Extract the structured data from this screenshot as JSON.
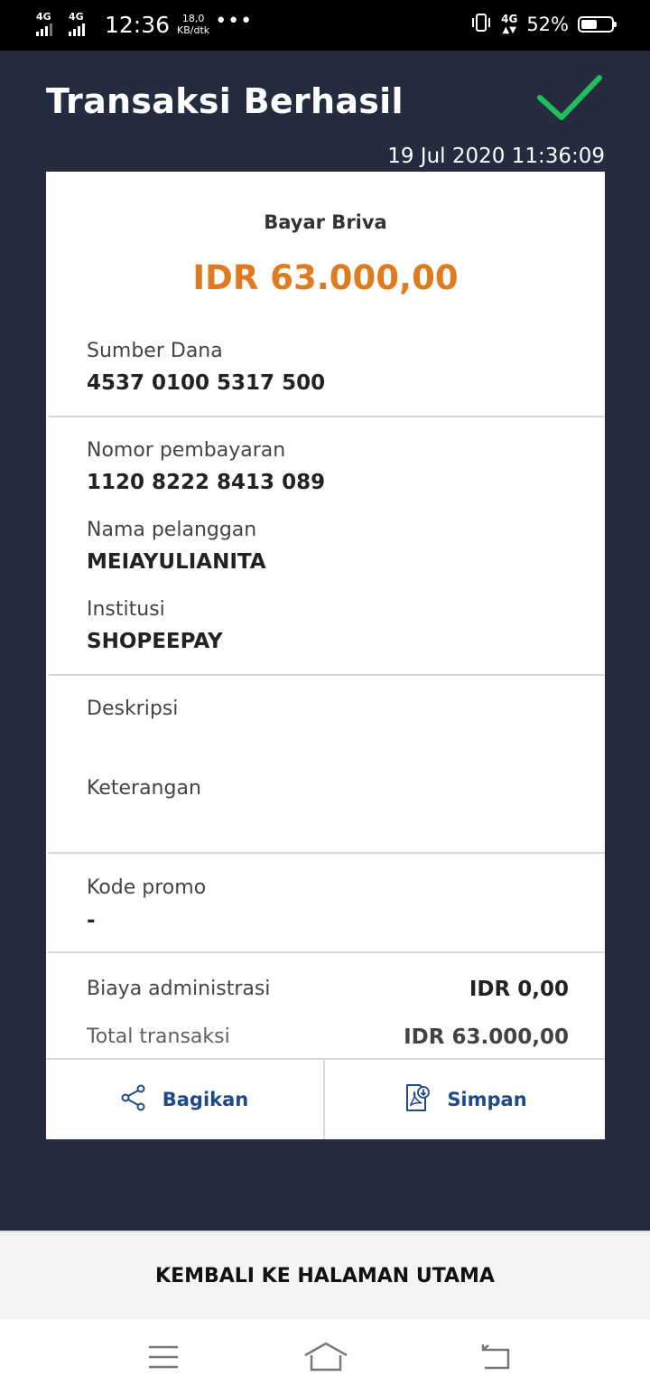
{
  "status_bar": {
    "network1": "4G",
    "network2": "4G",
    "time": "12:36",
    "speed_value": "18,0",
    "speed_unit": "KB/dtk",
    "dots": "•••",
    "network_right": "4G",
    "battery_percent": "52%",
    "battery_level": 0.52
  },
  "header": {
    "title": "Transaksi Berhasil",
    "timestamp": "19 Jul 2020 11:36:09",
    "check_color": "#1fbf5c"
  },
  "receipt": {
    "product": "Bayar Briva",
    "amount": "IDR 63.000,00",
    "amount_color": "#e07a1f",
    "source_label": "Sumber Dana",
    "source_value": "4537 0100 5317 500",
    "payment_no_label": "Nomor pembayaran",
    "payment_no_value": "1120 8222 8413 089",
    "customer_label": "Nama pelanggan",
    "customer_value": "MEIAYULIANITA",
    "institution_label": "Institusi",
    "institution_value": "SHOPEEPAY",
    "description_label": "Deskripsi",
    "notes_label": "Keterangan",
    "promo_label": "Kode promo",
    "promo_value": "-",
    "admin_fee_label": "Biaya administrasi",
    "admin_fee_value": "IDR 0,00",
    "total_label": "Total transaksi",
    "total_value": "IDR 63.000,00"
  },
  "actions": {
    "share_label": "Bagikan",
    "save_label": "Simpan",
    "accent_color": "#1e4a8a"
  },
  "footer": {
    "home_button_label": "KEMBALI KE HALAMAN UTAMA"
  },
  "nav_icons": [
    "menu-icon",
    "home-icon",
    "back-icon"
  ]
}
